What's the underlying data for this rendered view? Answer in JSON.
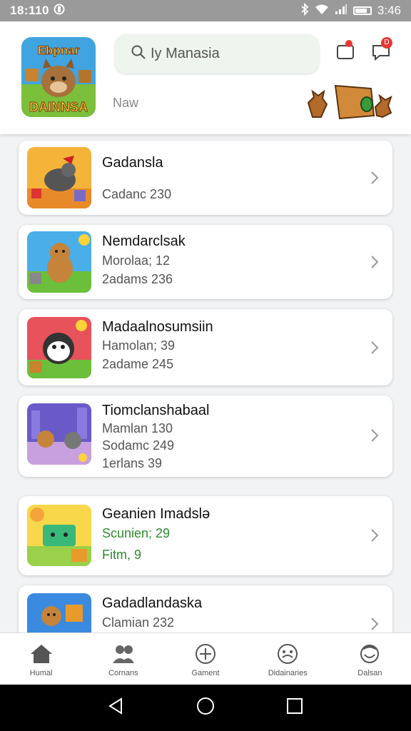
{
  "status_bar": {
    "time_left": "18:110",
    "time_right": "3:46"
  },
  "header": {
    "app_logo_text_top": "Ebpnar",
    "app_logo_text_bottom": "DAINNSA",
    "search_placeholder": "Iy Manasia",
    "tab_label": "Naw",
    "badge_notification": "",
    "badge_chat": "D"
  },
  "games": [
    {
      "title": "Gadansla",
      "lines": [
        "Cadanc 230"
      ]
    },
    {
      "title": "Nemdarclsak",
      "lines": [
        "Morolaa; 12",
        "2adams 236"
      ]
    },
    {
      "title": "Madaalnosumsiin",
      "lines": [
        "Hamolan; 39",
        "2adame 245"
      ]
    },
    {
      "title": "Tiomclanshabaal",
      "lines": [
        "Mamlan 130",
        "Sodamc 249",
        "1erlans 39"
      ]
    },
    {
      "title": "Geanien Imadslə",
      "lines": [
        "Scunien; 29",
        "Fitm, 9"
      ]
    },
    {
      "title": "Gadadlandaska",
      "lines": [
        "Clamian 232"
      ]
    }
  ],
  "bottom_nav": [
    {
      "label": "Humal",
      "icon": "home-icon"
    },
    {
      "label": "Cornans",
      "icon": "people-icon"
    },
    {
      "label": "Gament",
      "icon": "add-circle-icon"
    },
    {
      "label": "Didainaries",
      "icon": "face-icon"
    },
    {
      "label": "Dalsan",
      "icon": "profile-icon"
    }
  ],
  "colors": {
    "accent_green": "#2e8b2e",
    "badge_red": "#e53935",
    "status_bar": "#9a9a9a"
  }
}
